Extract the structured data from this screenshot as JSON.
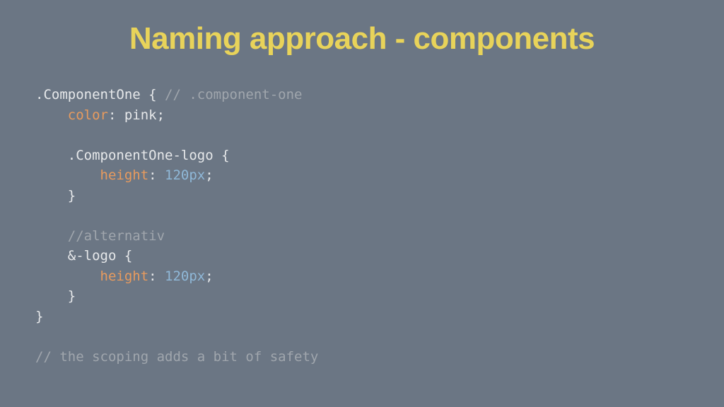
{
  "title": "Naming approach - components",
  "code": {
    "l1": {
      "a": ".ComponentOne { ",
      "b": "// .component-one"
    },
    "l2": {
      "a": "    ",
      "b": "color",
      "c": ": pink;"
    },
    "l3": "",
    "l4": "    .ComponentOne-logo {",
    "l5": {
      "a": "        ",
      "b": "height",
      "c": ": ",
      "d": "120px",
      "e": ";"
    },
    "l6": "    }",
    "l7": "",
    "l8": {
      "a": "    ",
      "b": "//alternativ"
    },
    "l9": "    &-logo {",
    "l10": {
      "a": "        ",
      "b": "height",
      "c": ": ",
      "d": "120px",
      "e": ";"
    },
    "l11": "    }",
    "l12": "}",
    "l13": "",
    "l14": "// the scoping adds a bit of safety"
  },
  "colors": {
    "background": "#6b7684",
    "title": "#e8d35a",
    "text": "#e6e8ea",
    "comment": "#a0a6ad",
    "property": "#e89b5e",
    "value": "#8fb8d8"
  }
}
